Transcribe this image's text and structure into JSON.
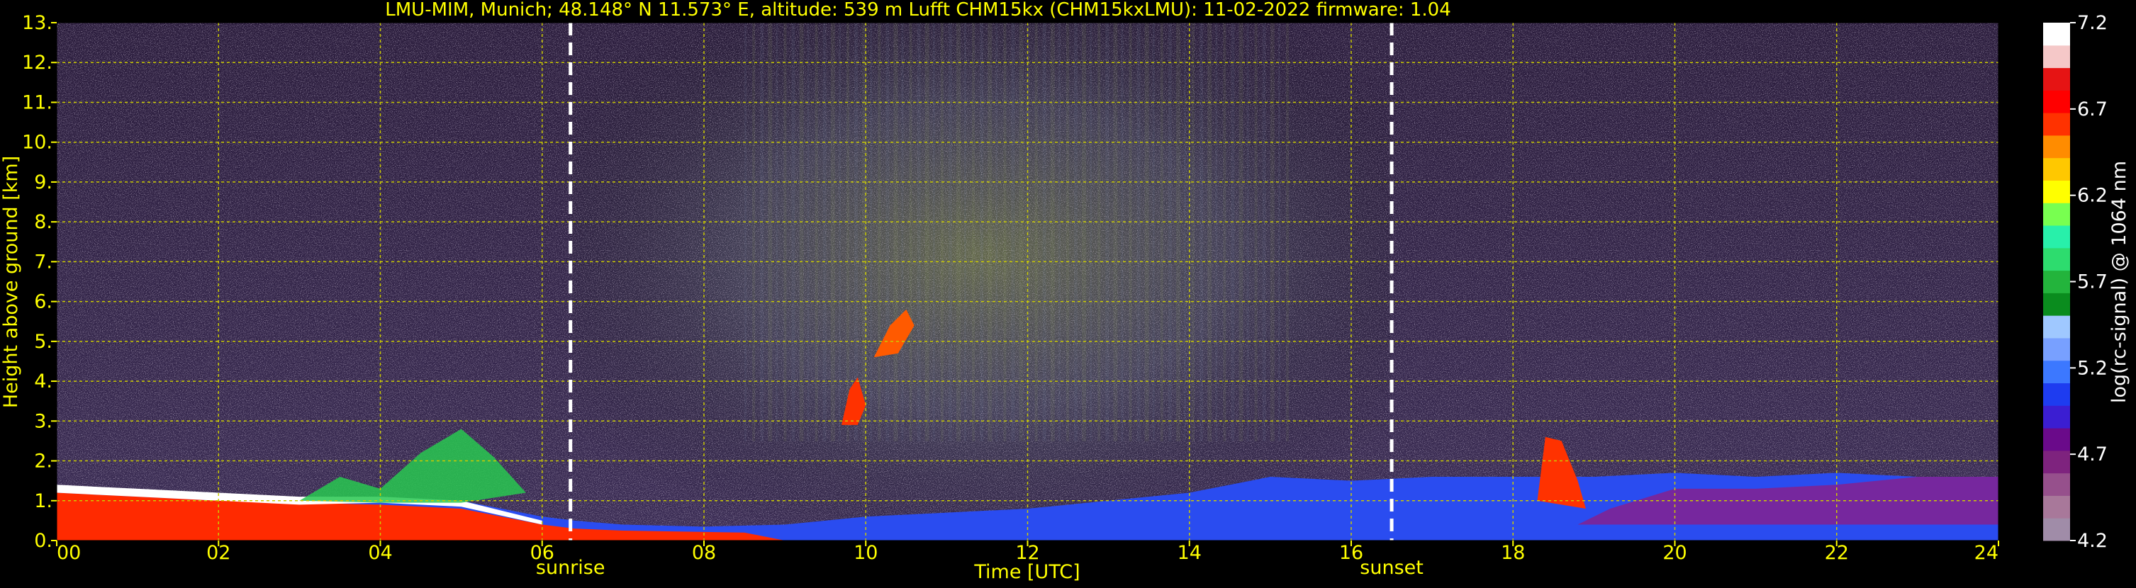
{
  "chart_data": {
    "type": "heatmap",
    "title": "LMU-MIM, Munich; 48.148° N 11.573° E, altitude: 539 m    Lufft CHM15kx (CHM15kxLMU): 11-02-2022    firmware: 1.04",
    "xlabel": "Time [UTC]",
    "ylabel": "Height above ground [km]",
    "colorbar_label": "log(rc-signal) @ 1064 nm",
    "xlim": [
      0,
      24
    ],
    "ylim": [
      0,
      13
    ],
    "x_ticks": [
      0,
      2,
      4,
      6,
      8,
      10,
      12,
      14,
      16,
      18,
      20,
      22,
      24
    ],
    "x_tick_labels": [
      "00",
      "02",
      "04",
      "06",
      "08",
      "10",
      "12",
      "14",
      "16",
      "18",
      "20",
      "22",
      "24"
    ],
    "y_ticks": [
      0,
      1,
      2,
      3,
      4,
      5,
      6,
      7,
      8,
      9,
      10,
      11,
      12,
      13
    ],
    "y_tick_labels": [
      "0.",
      "1.",
      "2.",
      "3.",
      "4.",
      "5.",
      "6.",
      "7.",
      "8.",
      "9.",
      "10.",
      "11.",
      "12.",
      "13."
    ],
    "clim": [
      4.2,
      7.2
    ],
    "colorbar_ticks": [
      4.2,
      4.7,
      5.2,
      5.7,
      6.2,
      6.7,
      7.2
    ],
    "colorbar_tick_labels": [
      "4.2",
      "4.7",
      "5.2",
      "5.7",
      "6.2",
      "6.7",
      "7.2"
    ],
    "grid": true,
    "annotations": [
      {
        "label": "sunrise",
        "x": 6.35
      },
      {
        "label": "sunset",
        "x": 16.5
      }
    ],
    "colors": {
      "background": "#000000",
      "axis_text": "#ffff00",
      "colorbar_text": "#ffffff",
      "grid": "#cccc00",
      "marker_line": "#ffffff"
    },
    "colormap": [
      "#a08ca8",
      "#a8789a",
      "#96508c",
      "#7e237e",
      "#6a0a8a",
      "#3b1ed2",
      "#1e3cf0",
      "#3c78ff",
      "#78a0ff",
      "#9fc8ff",
      "#0a8c1e",
      "#23b43c",
      "#2ddc6e",
      "#28f0aa",
      "#78ff50",
      "#ffff00",
      "#ffc800",
      "#ff8c00",
      "#ff3200",
      "#ff0000",
      "#e61414",
      "#f5c8c8",
      "#ffffff"
    ]
  }
}
